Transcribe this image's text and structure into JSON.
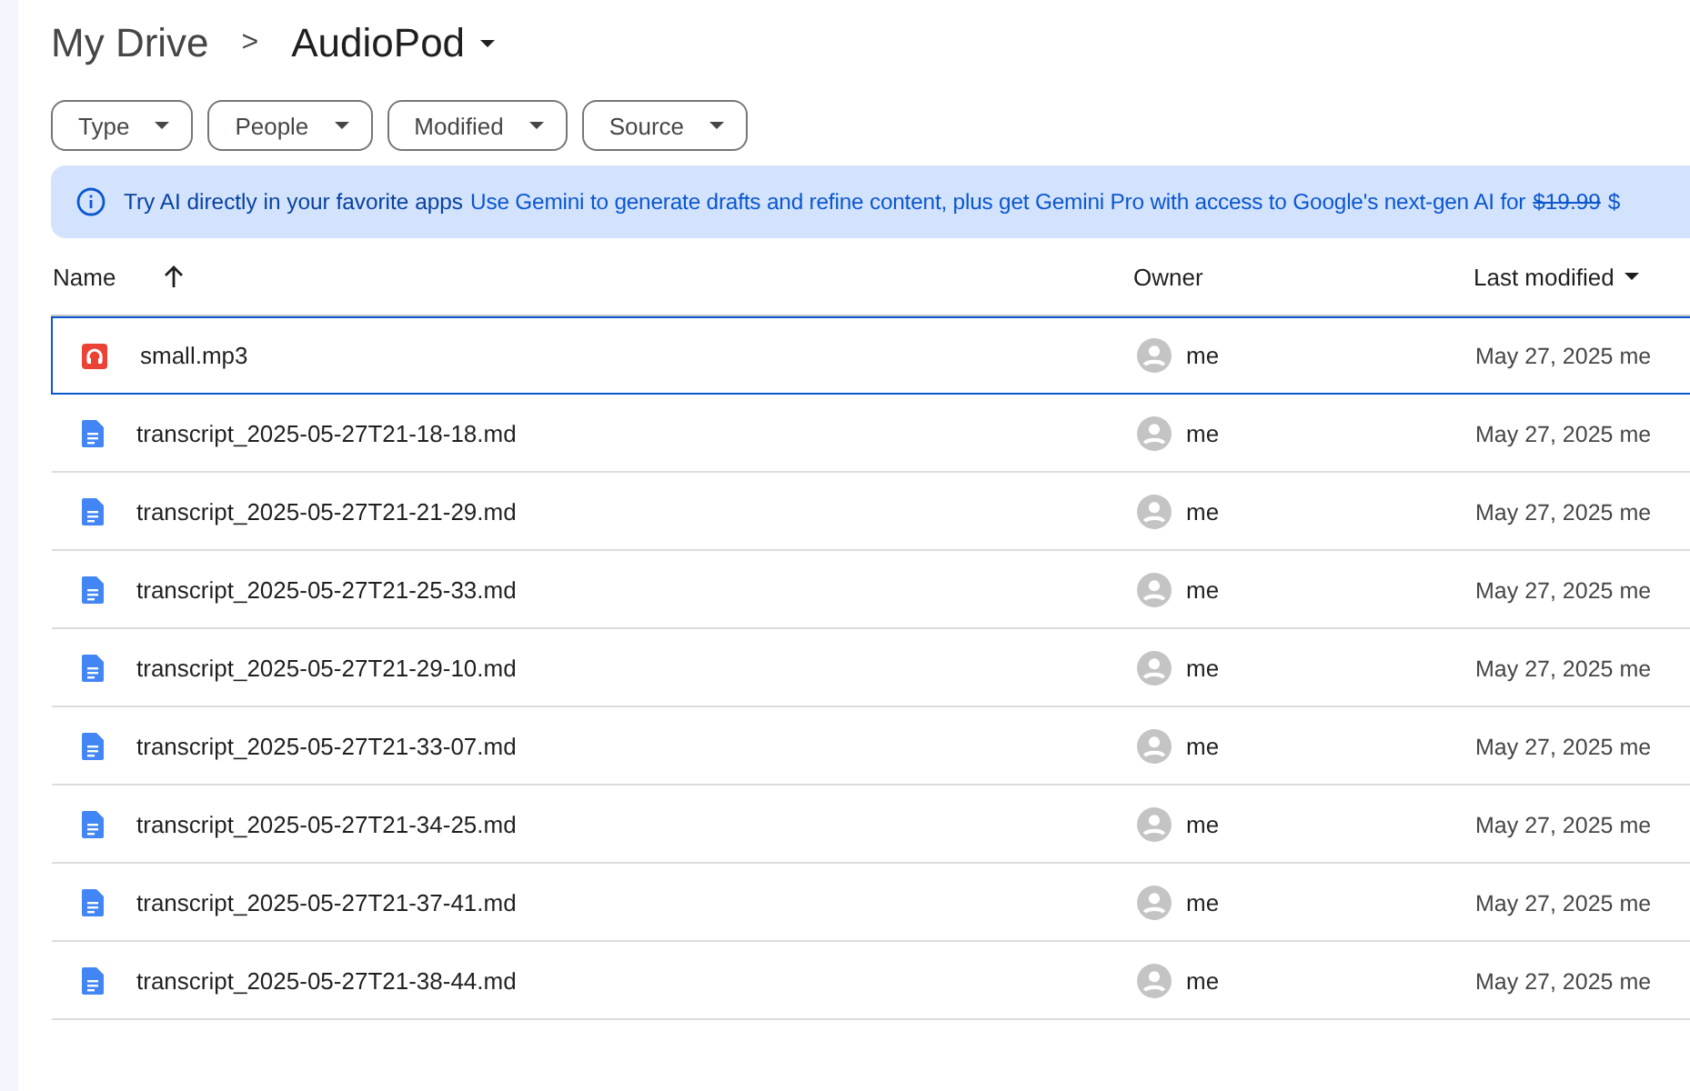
{
  "breadcrumb": {
    "parent": "My Drive",
    "separator": ">",
    "current": "AudioPod"
  },
  "filters": [
    {
      "label": "Type"
    },
    {
      "label": "People"
    },
    {
      "label": "Modified"
    },
    {
      "label": "Source"
    }
  ],
  "banner": {
    "title": "Try AI directly in your favorite apps",
    "message": "Use Gemini to generate drafts and refine content, plus get Gemini Pro with access to Google's next-gen AI for",
    "old_price": "$19.99",
    "price_fragment": "$"
  },
  "table": {
    "columns": [
      {
        "label": "Name",
        "sorted": true,
        "has_menu": false
      },
      {
        "label": "Owner",
        "sorted": false,
        "has_menu": false
      },
      {
        "label": "Last modified",
        "sorted": false,
        "has_menu": true
      }
    ],
    "rows": [
      {
        "kind": "audio",
        "name": "small.mp3",
        "owner": "me",
        "modified": "May 27, 2025 me",
        "selected": true
      },
      {
        "kind": "document",
        "name": "transcript_2025-05-27T21-18-18.md",
        "owner": "me",
        "modified": "May 27, 2025 me",
        "selected": false
      },
      {
        "kind": "document",
        "name": "transcript_2025-05-27T21-21-29.md",
        "owner": "me",
        "modified": "May 27, 2025 me",
        "selected": false
      },
      {
        "kind": "document",
        "name": "transcript_2025-05-27T21-25-33.md",
        "owner": "me",
        "modified": "May 27, 2025 me",
        "selected": false
      },
      {
        "kind": "document",
        "name": "transcript_2025-05-27T21-29-10.md",
        "owner": "me",
        "modified": "May 27, 2025 me",
        "selected": false
      },
      {
        "kind": "document",
        "name": "transcript_2025-05-27T21-33-07.md",
        "owner": "me",
        "modified": "May 27, 2025 me",
        "selected": false
      },
      {
        "kind": "document",
        "name": "transcript_2025-05-27T21-34-25.md",
        "owner": "me",
        "modified": "May 27, 2025 me",
        "selected": false
      },
      {
        "kind": "document",
        "name": "transcript_2025-05-27T21-37-41.md",
        "owner": "me",
        "modified": "May 27, 2025 me",
        "selected": false
      },
      {
        "kind": "document",
        "name": "transcript_2025-05-27T21-38-44.md",
        "owner": "me",
        "modified": "May 27, 2025 me",
        "selected": false
      }
    ]
  }
}
